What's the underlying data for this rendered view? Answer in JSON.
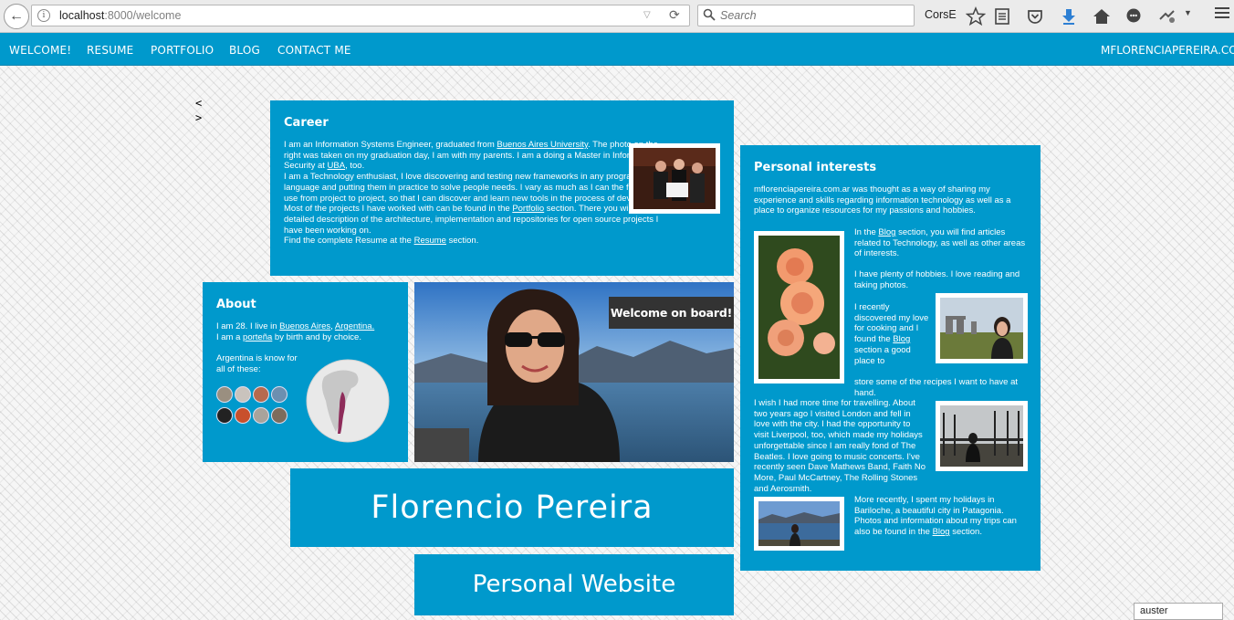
{
  "browser": {
    "url_host": "localhost",
    "url_rest": ":8000/welcome",
    "search_placeholder": "Search",
    "search_engine": "CorsE"
  },
  "nav": {
    "items": [
      "WELCOME!",
      "RESUME",
      "PORTFOLIO",
      "BLOG",
      "CONTACT ME"
    ],
    "brand": "MFLORENCIAPEREIRA.COM"
  },
  "carousel": {
    "prev": "<",
    "next": ">"
  },
  "career": {
    "title": "Career",
    "p1": "I am an Information Systems Engineer, graduated from ",
    "link_uba_full": "Buenos Aires University",
    "p2": ". The photo on the right was taken on my graduation day, I am with my parents. I am a doing a Master in Information Security at ",
    "link_uba": "UBA",
    "p3": ", too.",
    "p4": "I am a Technology enthusiast, I love discovering and testing new frameworks in any programming language and putting them in practice to solve people needs. I vary as much as I can the frameworks I use from project to project, so that I can discover and learn new tools in the process of development. Most of the projects I have worked with can be found in the ",
    "link_portfolio": "Portfolio",
    "p5": " section. There you will find a detailed description of the architecture, implementation and repositories for open source projects I have been working on.",
    "p6": "Find the complete Resume at the ",
    "link_resume": "Resume",
    "p7": " section."
  },
  "about": {
    "title": "About",
    "l1_a": "I am 28. I live in ",
    "link_ba": "Buenos Aires",
    "l1_b": ", ",
    "link_ar": "Argentina.",
    "l2_a": "I am a ",
    "link_portena": "porteña",
    "l2_b": " by birth and by choice.",
    "argentina_known": "Argentina is know for all of these:"
  },
  "welcome": {
    "badge": "Welcome on board!"
  },
  "hero": {
    "name": "Florencio Pereira",
    "subtitle": "Personal Website"
  },
  "interests": {
    "title": "Personal interests",
    "intro": "mflorenciapereira.com.ar was thought as a way of sharing my experience and skills regarding information technology as well as a place to organize resources for my passions and hobbies.",
    "blog_a": "In the ",
    "blog_link": "Blog",
    "blog_b": " section, you will find articles related to Technology, as well as other areas of interests.",
    "hobbies": "I have plenty of hobbies. I love reading and taking photos.",
    "cooking_a": "I recently discovered my love for cooking and I found the ",
    "cooking_link": "Blog",
    "cooking_b": " section a good place to",
    "cooking_c": "store some of the recipes I want to have at hand.",
    "travel": "I wish I had more time for travelling. About two years ago I visited London and fell in love with the city. I had the opportunity to visit Liverpool, too, which made my holidays unforgettable since I am really fond of The Beatles. I love going to music concerts. I've recently seen Dave Mathews Band, Faith No More, Paul McCartney, The Rolling Stones and Aerosmith.",
    "bariloche_a": "More recently, I spent my holidays in Bariloche, a beautiful city in Patagonia. Photos and information about my trips can also be found in the ",
    "bariloche_link": "Blog",
    "bariloche_b": " section."
  },
  "status": {
    "tooltip": "auster"
  }
}
